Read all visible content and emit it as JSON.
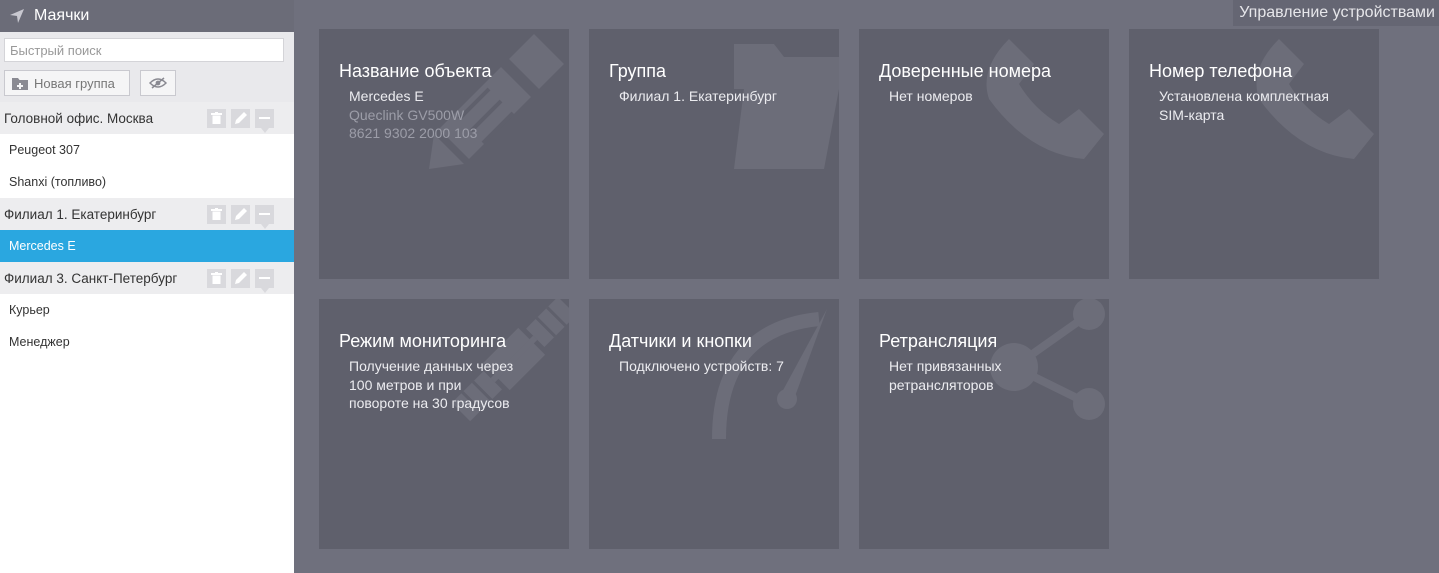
{
  "sidebar": {
    "title": "Маячки",
    "search_placeholder": "Быстрый поиск",
    "new_group_label": "Новая группа",
    "groups": [
      {
        "name": "Головной офис. Москва",
        "items": [
          "Peugeot 307",
          "Shanxi (топливо)"
        ]
      },
      {
        "name": "Филиал 1. Екатеринбург",
        "items": [
          "Mercedes E"
        ]
      },
      {
        "name": "Филиал 3. Санкт-Петербург",
        "items": [
          "Курьер",
          "Менеджер"
        ]
      }
    ],
    "selected_item": "Mercedes E"
  },
  "main": {
    "title": "Управление устройствами",
    "tiles": {
      "object": {
        "title": "Название объекта",
        "name": "Mercedes E",
        "model": "Queclink GV500W",
        "imei": "8621 9302 2000 103",
        "icon": "pencil-icon"
      },
      "group": {
        "title": "Группа",
        "value": "Филиал 1. Екатеринбург",
        "icon": "folder-icon"
      },
      "trusted": {
        "title": "Доверенные номера",
        "value": "Нет номеров",
        "icon": "phone-icon"
      },
      "phone": {
        "title": "Номер телефона",
        "value_line1": "Установлена комплектная",
        "value_line2": "SIM-карта",
        "icon": "phone-icon"
      },
      "monitoring": {
        "title": "Режим мониторинга",
        "line1": "Получение данных через",
        "line2": "100 метров и при",
        "line3": "повороте на 30 градусов",
        "icon": "satellite-icon"
      },
      "sensors": {
        "title": "Датчики и кнопки",
        "value": "Подключено устройств: 7",
        "icon": "gauge-icon"
      },
      "relay": {
        "title": "Ретрансляция",
        "line1": "Нет привязанных",
        "line2": "ретрансляторов",
        "icon": "share-icon"
      }
    }
  },
  "colors": {
    "selected": "#2aa7e0",
    "main_bg": "#6f707d",
    "tile_bg": "#5f606c",
    "header_bg": "#6b6c78"
  }
}
